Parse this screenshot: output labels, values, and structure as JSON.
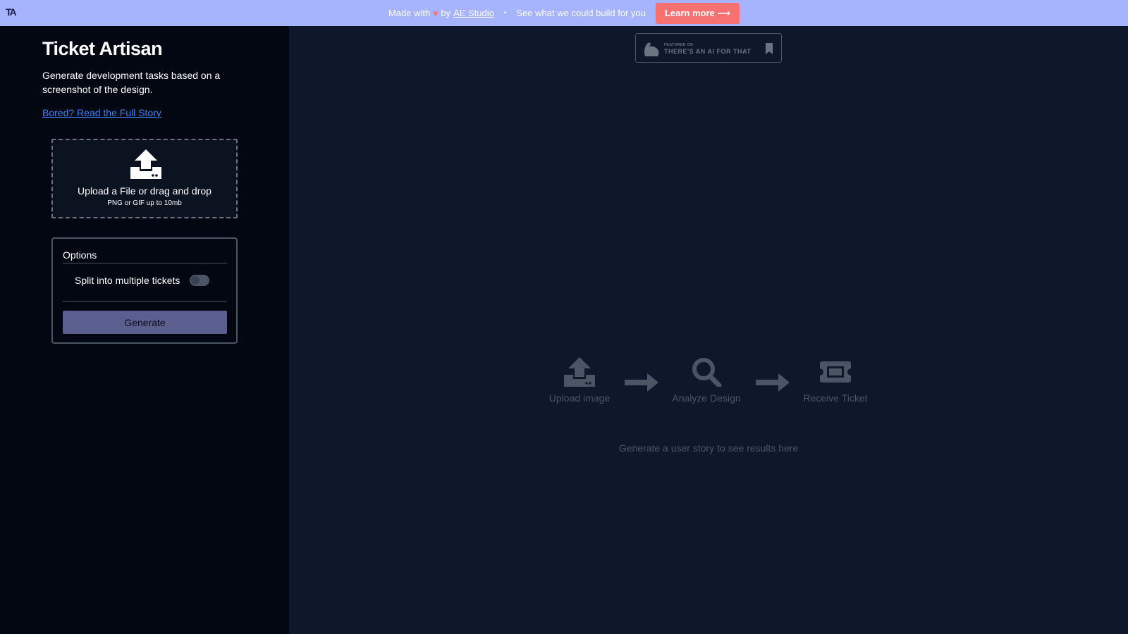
{
  "banner": {
    "logo": "TA",
    "made_with": "Made with",
    "by": "by",
    "studio_link": "AE Studio",
    "separator": "•",
    "pitch": "See what we could build for you",
    "learn_more": "Learn more ⟶"
  },
  "sidebar": {
    "title": "Ticket Artisan",
    "description": "Generate development tasks based on a screenshot of the design.",
    "story_link": "Bored? Read the Full Story",
    "upload": {
      "main": "Upload a File or drag and drop",
      "sub": "PNG or GIF up to 10mb"
    },
    "options": {
      "title": "Options",
      "split_label": "Split into multiple tickets",
      "split_enabled": false,
      "generate_label": "Generate"
    }
  },
  "main": {
    "badge": {
      "small": "FEATURED ON",
      "big": "THERE'S AN AI FOR THAT"
    },
    "steps": [
      {
        "icon": "upload-icon",
        "label": "Upload image"
      },
      {
        "icon": "magnifier-icon",
        "label": "Analyze Design"
      },
      {
        "icon": "ticket-icon",
        "label": "Receive Ticket"
      }
    ],
    "hint": "Generate a user story to see results here"
  },
  "colors": {
    "banner_bg": "#a5b4fc",
    "accent_button": "#f87171",
    "link": "#3b82f6",
    "generate_button": "#5b5f8f",
    "muted": "#4b5563"
  }
}
